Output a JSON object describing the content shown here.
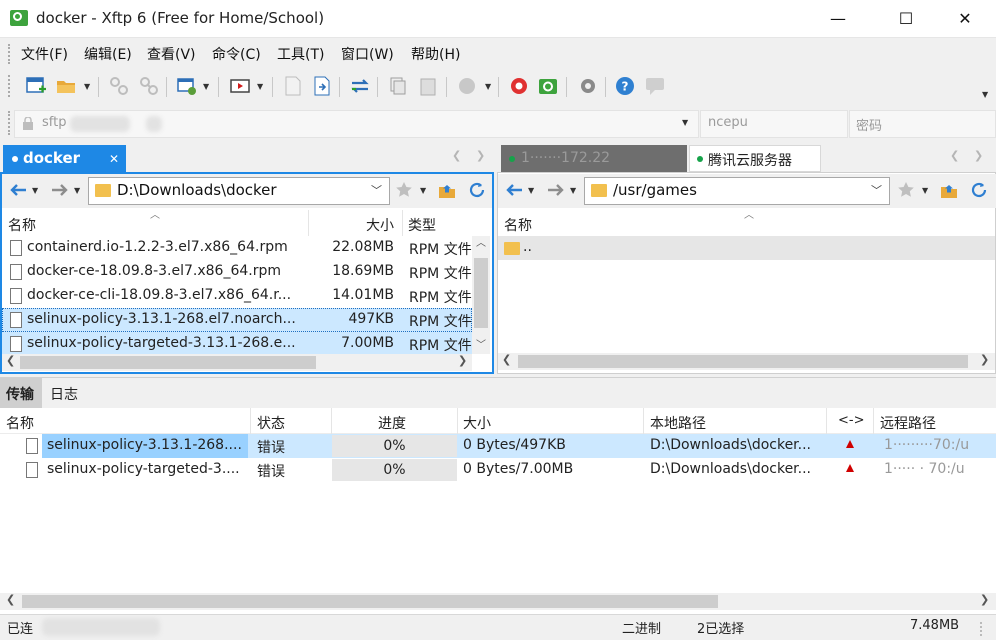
{
  "window": {
    "title": "docker - Xftp 6 (Free for Home/School)",
    "minimize": "—",
    "maximize": "☐",
    "close": "✕"
  },
  "menu": [
    "文件(F)",
    "编辑(E)",
    "查看(V)",
    "命令(C)",
    "工具(T)",
    "窗口(W)",
    "帮助(H)"
  ],
  "address": {
    "host_placeholder": "sftp",
    "user": "ncepu",
    "password_placeholder": "密码"
  },
  "left_pane": {
    "tab_label": "docker",
    "tab_close": "✕",
    "path": "D:\\Downloads\\docker",
    "columns": {
      "name": "名称",
      "size": "大小",
      "type": "类型"
    },
    "files": [
      {
        "name": "containerd.io-1.2.2-3.el7.x86_64.rpm",
        "size": "22.08MB",
        "type": "RPM 文件"
      },
      {
        "name": "docker-ce-18.09.8-3.el7.x86_64.rpm",
        "size": "18.69MB",
        "type": "RPM 文件"
      },
      {
        "name": "docker-ce-cli-18.09.8-3.el7.x86_64.r...",
        "size": "14.01MB",
        "type": "RPM 文件"
      },
      {
        "name": "selinux-policy-3.13.1-268.el7.noarch...",
        "size": "497KB",
        "type": "RPM 文件"
      },
      {
        "name": "selinux-policy-targeted-3.13.1-268.e...",
        "size": "7.00MB",
        "type": "RPM 文件"
      }
    ]
  },
  "right_pane": {
    "tab1_label": "1·······172.22",
    "tab2_label": "腾讯云服务器",
    "path": "/usr/games",
    "columns": {
      "name": "名称"
    },
    "files": [
      {
        "name": ".."
      }
    ]
  },
  "transfer": {
    "tabs": [
      "传输",
      "日志"
    ],
    "columns": {
      "name": "名称",
      "status": "状态",
      "progress": "进度",
      "size": "大小",
      "local": "本地路径",
      "dir": "<->",
      "remote": "远程路径"
    },
    "rows": [
      {
        "name": "selinux-policy-3.13.1-268....",
        "status": "错误",
        "progress": "0%",
        "progress_value": 0,
        "size": "0 Bytes/497KB",
        "local": "D:\\Downloads\\docker...",
        "remote": "1·········70:/u"
      },
      {
        "name": "selinux-policy-targeted-3....",
        "status": "错误",
        "progress": "0%",
        "progress_value": 0,
        "size": "0 Bytes/7.00MB",
        "local": "D:\\Downloads\\docker...",
        "remote": "1····· · 70:/u"
      }
    ]
  },
  "statusbar": {
    "connection": "已连",
    "mode": "二进制",
    "selected": "2已选择",
    "size": "7.48MB"
  },
  "colors": {
    "accent": "#1e88e5",
    "selection": "#cce8ff",
    "selection_active": "#99d1ff",
    "error_arrow": "#d00000",
    "online_dot": "#16a34a"
  },
  "icons": [
    "new-session-icon",
    "open-folder-icon",
    "disconnect-icon",
    "reconnect-icon",
    "properties-icon",
    "terminal-icon",
    "upload-icon",
    "download-icon",
    "sync-icon",
    "copy-icon",
    "paste-icon",
    "record-icon",
    "xshell-icon",
    "xftp-icon",
    "settings-icon",
    "help-icon",
    "chat-icon"
  ]
}
